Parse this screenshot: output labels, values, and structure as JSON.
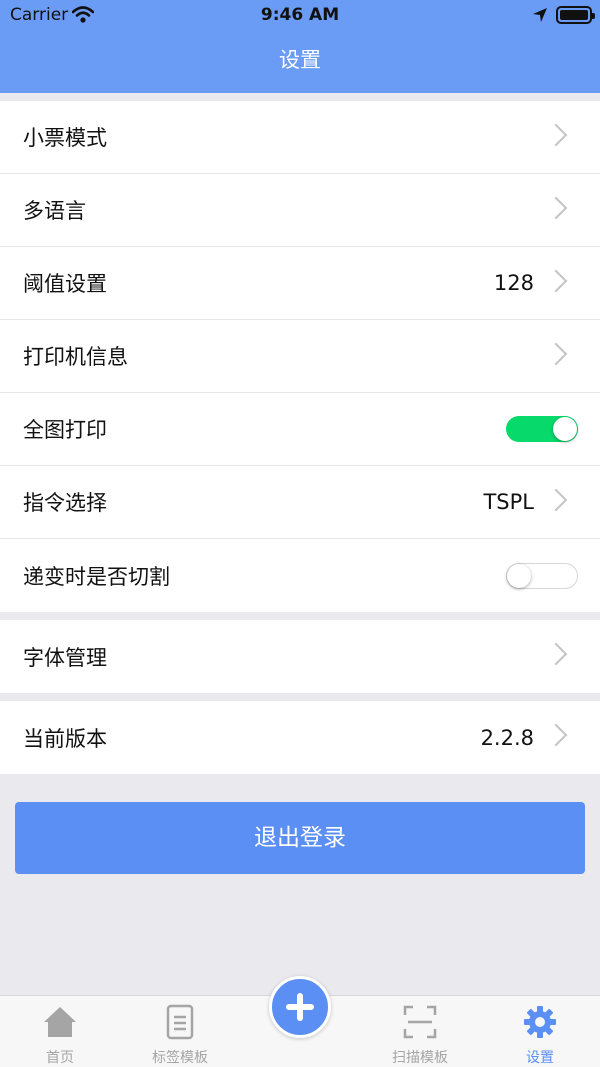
{
  "status_bar": {
    "carrier": "Carrier",
    "time": "9:46 AM"
  },
  "header": {
    "title": "设置",
    "color": "#6b9cf5"
  },
  "groups": [
    {
      "rows": [
        {
          "label": "小票模式",
          "value": "",
          "control": "chevron"
        },
        {
          "label": "多语言",
          "value": "",
          "control": "chevron"
        },
        {
          "label": "阈值设置",
          "value": "128",
          "control": "chevron"
        },
        {
          "label": "打印机信息",
          "value": "",
          "control": "chevron"
        },
        {
          "label": "全图打印",
          "value": "",
          "control": "toggle",
          "toggle_on": true
        },
        {
          "label": "指令选择",
          "value": "TSPL",
          "control": "chevron"
        },
        {
          "label": "递变时是否切割",
          "value": "",
          "control": "toggle",
          "toggle_on": false
        }
      ]
    },
    {
      "rows": [
        {
          "label": "字体管理",
          "value": "",
          "control": "chevron"
        }
      ]
    },
    {
      "rows": [
        {
          "label": "当前版本",
          "value": "2.2.8",
          "control": "chevron"
        }
      ]
    }
  ],
  "logout_label": "退出登录",
  "tabbar": {
    "tabs": [
      {
        "label": "首页",
        "icon": "home-icon",
        "active": false
      },
      {
        "label": "标签模板",
        "icon": "document-icon",
        "active": false
      },
      {
        "label": "扫描模板",
        "icon": "scan-icon",
        "active": false
      },
      {
        "label": "设置",
        "icon": "gear-icon",
        "active": true
      }
    ],
    "fab_icon": "plus-icon",
    "accent_color": "#5b8ff3",
    "inactive_color": "#a5a5a5"
  },
  "colors": {
    "toggle_on": "#07d96b",
    "background": "#e9e9ee"
  }
}
